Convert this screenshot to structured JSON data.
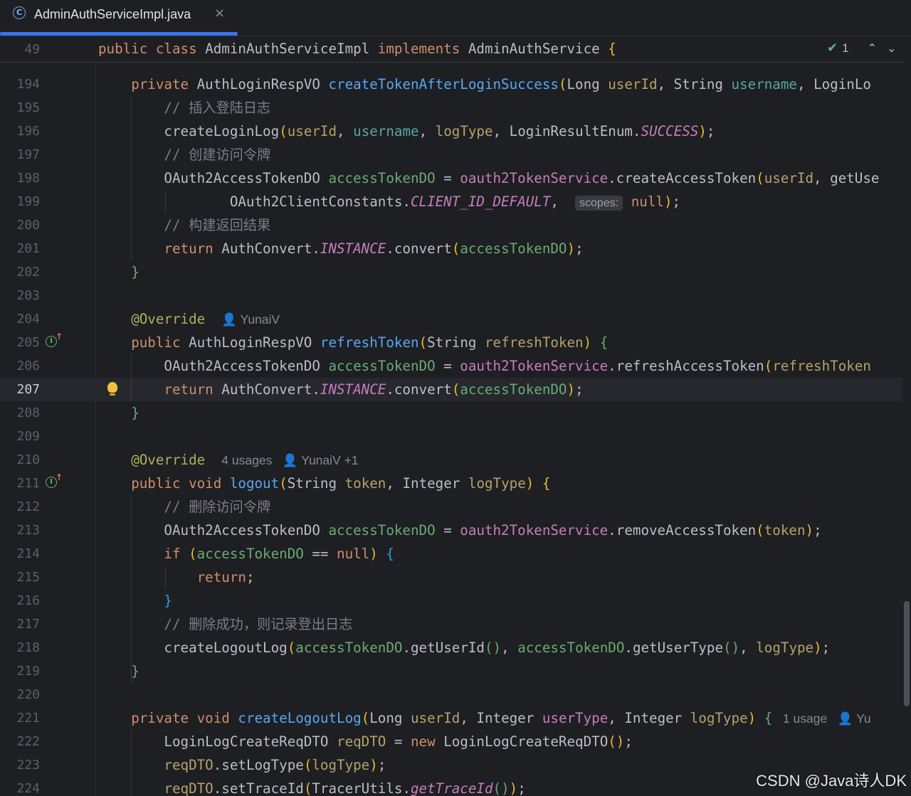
{
  "tab": {
    "title": "AdminAuthServiceImpl.java",
    "close": "×"
  },
  "sticky": {
    "line_number": "49",
    "text": [
      {
        "t": "public ",
        "c": "k"
      },
      {
        "t": "class ",
        "c": "k"
      },
      {
        "t": "AdminAuthServiceImpl ",
        "c": "v"
      },
      {
        "t": "implements ",
        "c": "k"
      },
      {
        "t": "AdminAuthService ",
        "c": "v"
      },
      {
        "t": "{",
        "c": "y"
      }
    ]
  },
  "inspection": {
    "count": "1",
    "check_icon": "✔",
    "up": "⌃",
    "down": "⌄"
  },
  "lines": [
    {
      "n": "194",
      "s": [
        {
          "t": "    private ",
          "c": "k"
        },
        {
          "t": "AuthLoginRespVO ",
          "c": "v"
        },
        {
          "t": "createTokenAfterLoginSuccess",
          "c": "m"
        },
        {
          "t": "(",
          "c": "y"
        },
        {
          "t": "Long ",
          "c": "v"
        },
        {
          "t": "userId",
          "c": "prm"
        },
        {
          "t": ", ",
          "c": "v"
        },
        {
          "t": "String ",
          "c": "v"
        },
        {
          "t": "username",
          "c": "un"
        },
        {
          "t": ", LoginLo",
          "c": "v"
        }
      ]
    },
    {
      "n": "195",
      "s": [
        {
          "t": "        // 插入登陆日志",
          "c": "c"
        }
      ]
    },
    {
      "n": "196",
      "s": [
        {
          "t": "        createLoginLog",
          "c": "v"
        },
        {
          "t": "(",
          "c": "y"
        },
        {
          "t": "userId",
          "c": "prm"
        },
        {
          "t": ", ",
          "c": "v"
        },
        {
          "t": "username",
          "c": "un"
        },
        {
          "t": ", ",
          "c": "v"
        },
        {
          "t": "logType",
          "c": "prm"
        },
        {
          "t": ", LoginResultEnum.",
          "c": "v"
        },
        {
          "t": "SUCCESS",
          "c": "pi"
        },
        {
          "t": ")",
          "c": "y"
        },
        {
          "t": ";",
          "c": "v"
        }
      ]
    },
    {
      "n": "197",
      "s": [
        {
          "t": "        // 创建访问令牌",
          "c": "c"
        }
      ]
    },
    {
      "n": "198",
      "s": [
        {
          "t": "        OAuth2AccessTokenDO ",
          "c": "v"
        },
        {
          "t": "accessTokenDO",
          "c": "lv"
        },
        {
          "t": " = ",
          "c": "v"
        },
        {
          "t": "oauth2TokenService",
          "c": "p"
        },
        {
          "t": ".createAccessToken",
          "c": "v"
        },
        {
          "t": "(",
          "c": "y"
        },
        {
          "t": "userId",
          "c": "prm"
        },
        {
          "t": ", getUse",
          "c": "v"
        }
      ]
    },
    {
      "n": "199",
      "s": [
        {
          "t": "                OAuth2ClientConstants.",
          "c": "v"
        },
        {
          "t": "CLIENT_ID_DEFAULT",
          "c": "pi"
        },
        {
          "t": ",  ",
          "c": "v"
        },
        {
          "t": "scopes:",
          "c": "hint"
        },
        {
          "t": " null",
          "c": "k"
        },
        {
          "t": ")",
          "c": "y"
        },
        {
          "t": ";",
          "c": "v"
        }
      ]
    },
    {
      "n": "200",
      "s": [
        {
          "t": "        // 构建返回结果",
          "c": "c"
        }
      ]
    },
    {
      "n": "201",
      "s": [
        {
          "t": "        return ",
          "c": "k"
        },
        {
          "t": "AuthConvert.",
          "c": "v"
        },
        {
          "t": "INSTANCE",
          "c": "pi"
        },
        {
          "t": ".convert",
          "c": "v"
        },
        {
          "t": "(",
          "c": "y"
        },
        {
          "t": "accessTokenDO",
          "c": "lv"
        },
        {
          "t": ")",
          "c": "y"
        },
        {
          "t": ";",
          "c": "v"
        }
      ]
    },
    {
      "n": "202",
      "s": [
        {
          "t": "    }",
          "c": "g"
        }
      ]
    },
    {
      "n": "203",
      "s": []
    },
    {
      "n": "204",
      "s": [
        {
          "t": "    @Override",
          "c": "ann"
        },
        {
          "t": "  ",
          "c": "v"
        },
        {
          "t": "👤 YunaiV",
          "c": "inlay"
        }
      ]
    },
    {
      "n": "205",
      "s": [
        {
          "t": "    public ",
          "c": "k"
        },
        {
          "t": "AuthLoginRespVO ",
          "c": "v"
        },
        {
          "t": "refreshToken",
          "c": "m"
        },
        {
          "t": "(",
          "c": "y"
        },
        {
          "t": "String ",
          "c": "v"
        },
        {
          "t": "refreshToken",
          "c": "prm"
        },
        {
          "t": ") ",
          "c": "y"
        },
        {
          "t": "{",
          "c": "g"
        }
      ],
      "impl": true
    },
    {
      "n": "206",
      "s": [
        {
          "t": "        OAuth2AccessTokenDO ",
          "c": "v"
        },
        {
          "t": "accessTokenDO",
          "c": "lv"
        },
        {
          "t": " = ",
          "c": "v"
        },
        {
          "t": "oauth2TokenService",
          "c": "p"
        },
        {
          "t": ".refreshAccessToken",
          "c": "v"
        },
        {
          "t": "(",
          "c": "y"
        },
        {
          "t": "refreshToken",
          "c": "prm"
        }
      ]
    },
    {
      "n": "207",
      "s": [
        {
          "t": "        return ",
          "c": "k"
        },
        {
          "t": "AuthConvert.",
          "c": "v"
        },
        {
          "t": "INSTANCE",
          "c": "pi"
        },
        {
          "t": ".convert",
          "c": "v"
        },
        {
          "t": "(",
          "c": "y"
        },
        {
          "t": "accessTokenDO",
          "c": "lv"
        },
        {
          "t": ")",
          "c": "y"
        },
        {
          "t": ";",
          "c": "v"
        }
      ],
      "current": true,
      "bulb": true
    },
    {
      "n": "208",
      "s": [
        {
          "t": "    }",
          "c": "g"
        }
      ]
    },
    {
      "n": "209",
      "s": []
    },
    {
      "n": "210",
      "s": [
        {
          "t": "    @Override",
          "c": "ann"
        },
        {
          "t": "  ",
          "c": "v"
        },
        {
          "t": "4 usages   👤 YunaiV +1",
          "c": "inlay"
        }
      ]
    },
    {
      "n": "211",
      "s": [
        {
          "t": "    public ",
          "c": "k"
        },
        {
          "t": "void ",
          "c": "k"
        },
        {
          "t": "logout",
          "c": "m"
        },
        {
          "t": "(",
          "c": "y"
        },
        {
          "t": "String ",
          "c": "v"
        },
        {
          "t": "token",
          "c": "prm"
        },
        {
          "t": ", ",
          "c": "v"
        },
        {
          "t": "Integer ",
          "c": "v"
        },
        {
          "t": "logType",
          "c": "prm"
        },
        {
          "t": ") ",
          "c": "y"
        },
        {
          "t": "{",
          "c": "y"
        }
      ],
      "impl": true
    },
    {
      "n": "212",
      "s": [
        {
          "t": "        // 删除访问令牌",
          "c": "c"
        }
      ]
    },
    {
      "n": "213",
      "s": [
        {
          "t": "        OAuth2AccessTokenDO ",
          "c": "v"
        },
        {
          "t": "accessTokenDO",
          "c": "lv"
        },
        {
          "t": " = ",
          "c": "v"
        },
        {
          "t": "oauth2TokenService",
          "c": "p"
        },
        {
          "t": ".removeAccessToken",
          "c": "v"
        },
        {
          "t": "(",
          "c": "y"
        },
        {
          "t": "token",
          "c": "prm"
        },
        {
          "t": ")",
          "c": "y"
        },
        {
          "t": ";",
          "c": "v"
        }
      ]
    },
    {
      "n": "214",
      "s": [
        {
          "t": "        if ",
          "c": "k"
        },
        {
          "t": "(",
          "c": "y"
        },
        {
          "t": "accessTokenDO",
          "c": "lv"
        },
        {
          "t": " == ",
          "c": "v"
        },
        {
          "t": "null",
          "c": "k"
        },
        {
          "t": ") ",
          "c": "y"
        },
        {
          "t": "{",
          "c": "cb"
        }
      ]
    },
    {
      "n": "215",
      "s": [
        {
          "t": "            return",
          "c": "k"
        },
        {
          "t": ";",
          "c": "v"
        }
      ]
    },
    {
      "n": "216",
      "s": [
        {
          "t": "        }",
          "c": "cb"
        }
      ]
    },
    {
      "n": "217",
      "s": [
        {
          "t": "        // 删除成功，则记录登出日志",
          "c": "c"
        }
      ]
    },
    {
      "n": "218",
      "s": [
        {
          "t": "        createLogoutLog",
          "c": "v"
        },
        {
          "t": "(",
          "c": "y"
        },
        {
          "t": "accessTokenDO",
          "c": "lv"
        },
        {
          "t": ".getUserId",
          "c": "v"
        },
        {
          "t": "()",
          "c": "g"
        },
        {
          "t": ", ",
          "c": "v"
        },
        {
          "t": "accessTokenDO",
          "c": "lv"
        },
        {
          "t": ".getUserType",
          "c": "v"
        },
        {
          "t": "()",
          "c": "g"
        },
        {
          "t": ", ",
          "c": "v"
        },
        {
          "t": "logType",
          "c": "prm"
        },
        {
          "t": ")",
          "c": "y"
        },
        {
          "t": ";",
          "c": "v"
        }
      ]
    },
    {
      "n": "219",
      "s": [
        {
          "t": "    }",
          "c": "g"
        }
      ]
    },
    {
      "n": "220",
      "s": []
    },
    {
      "n": "221",
      "s": [
        {
          "t": "    private ",
          "c": "k"
        },
        {
          "t": "void ",
          "c": "k"
        },
        {
          "t": "createLogoutLog",
          "c": "m"
        },
        {
          "t": "(",
          "c": "y"
        },
        {
          "t": "Long ",
          "c": "v"
        },
        {
          "t": "userId",
          "c": "prm"
        },
        {
          "t": ", ",
          "c": "v"
        },
        {
          "t": "Integer ",
          "c": "v"
        },
        {
          "t": "userType",
          "c": "p"
        },
        {
          "t": ", ",
          "c": "v"
        },
        {
          "t": "Integer ",
          "c": "v"
        },
        {
          "t": "logType",
          "c": "prm"
        },
        {
          "t": ") ",
          "c": "y"
        },
        {
          "t": "{",
          "c": "g"
        },
        {
          "t": "   1 usage   👤 Yu",
          "c": "inlay"
        }
      ]
    },
    {
      "n": "222",
      "s": [
        {
          "t": "        LoginLogCreateReqDTO ",
          "c": "v"
        },
        {
          "t": "reqDTO",
          "c": "prm"
        },
        {
          "t": " = ",
          "c": "v"
        },
        {
          "t": "new ",
          "c": "k"
        },
        {
          "t": "LoginLogCreateReqDTO",
          "c": "v"
        },
        {
          "t": "()",
          "c": "y"
        },
        {
          "t": ";",
          "c": "v"
        }
      ]
    },
    {
      "n": "223",
      "s": [
        {
          "t": "        reqDTO",
          "c": "prm"
        },
        {
          "t": ".setLogType",
          "c": "v"
        },
        {
          "t": "(",
          "c": "y"
        },
        {
          "t": "logType",
          "c": "prm"
        },
        {
          "t": ")",
          "c": "y"
        },
        {
          "t": ";",
          "c": "v"
        }
      ]
    },
    {
      "n": "224",
      "s": [
        {
          "t": "        reqDTO",
          "c": "prm"
        },
        {
          "t": ".setTraceId",
          "c": "v"
        },
        {
          "t": "(",
          "c": "y"
        },
        {
          "t": "TracerUtils.",
          "c": "v"
        },
        {
          "t": "getTraceId",
          "c": "pi"
        },
        {
          "t": "()",
          "c": "g"
        },
        {
          "t": ")",
          "c": "y"
        },
        {
          "t": ";",
          "c": "v"
        }
      ]
    }
  ],
  "watermark": "CSDN @Java诗人DK"
}
